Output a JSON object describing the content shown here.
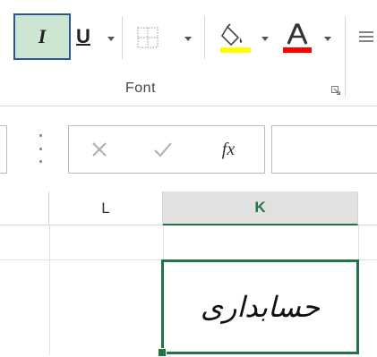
{
  "ribbon": {
    "italic_label": "I",
    "underline_label": "U",
    "group_label": "Font",
    "fill_color": "#ffff00",
    "font_color": "#ff0000"
  },
  "formula_bar": {
    "fx_label": "fx",
    "cancel_icon": "close-icon",
    "enter_icon": "checkmark-icon"
  },
  "grid": {
    "columns": [
      "L",
      "K"
    ],
    "active_column": "K",
    "active_cell_value": "حسابداری",
    "accent_color": "#217346"
  }
}
